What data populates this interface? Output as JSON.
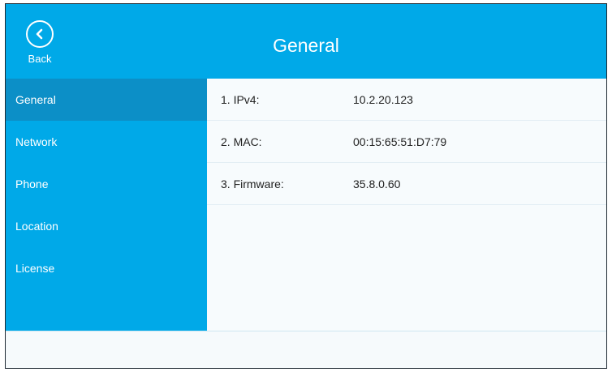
{
  "header": {
    "title": "General",
    "back_label": "Back"
  },
  "sidebar": {
    "items": [
      {
        "label": "General",
        "active": true
      },
      {
        "label": "Network",
        "active": false
      },
      {
        "label": "Phone",
        "active": false
      },
      {
        "label": "Location",
        "active": false
      },
      {
        "label": "License",
        "active": false
      }
    ]
  },
  "content": {
    "rows": [
      {
        "key": "1. IPv4:",
        "value": "10.2.20.123"
      },
      {
        "key": "2. MAC:",
        "value": "00:15:65:51:D7:79"
      },
      {
        "key": "3. Firmware:",
        "value": "35.8.0.60"
      }
    ]
  },
  "colors": {
    "accent": "#00a9e8",
    "active_item": "#0c8fc7",
    "content_bg": "#f7fbfd"
  },
  "icons": {
    "back": "chevron-left-circle-icon"
  }
}
